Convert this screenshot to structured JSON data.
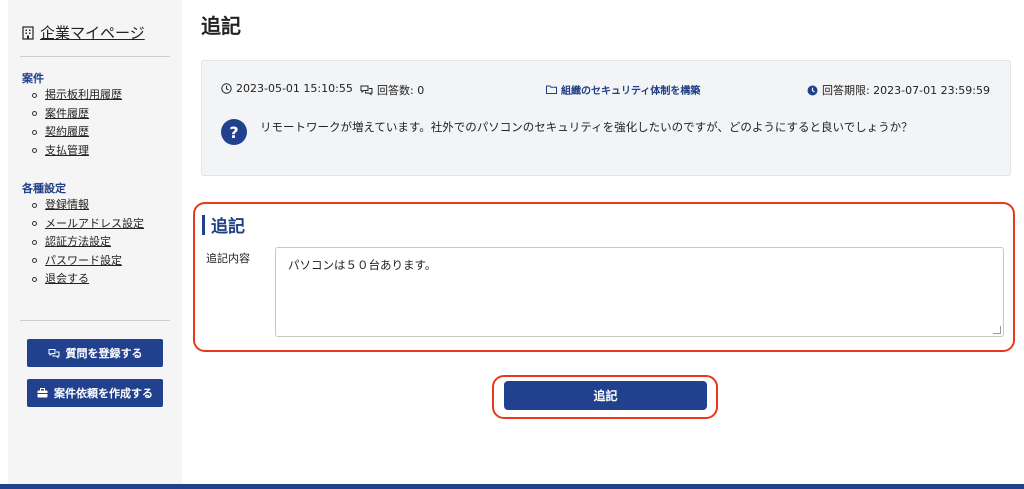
{
  "sidebar": {
    "brand": "企業マイページ",
    "section1_title": "案件",
    "section1_items": [
      "掲示板利用履歴",
      "案件履歴",
      "契約履歴",
      "支払管理"
    ],
    "section2_title": "各種設定",
    "section2_items": [
      "登録情報",
      "メールアドレス設定",
      "認証方法設定",
      "パスワード設定",
      "退会する"
    ],
    "buttons": {
      "register_question": "質問を登録する",
      "create_request": "案件依頼を作成する"
    }
  },
  "main": {
    "title": "追記",
    "question": {
      "posted_at": "2023-05-01 15:10:55",
      "answer_count": "回答数: 0",
      "category": "組織のセキュリティ体制を構築",
      "deadline": "回答期限: 2023-07-01 23:59:59",
      "text": "リモートワークが増えています。社外でのパソコンのセキュリティを強化したいのですが、どのようにすると良いでしょうか？",
      "icon_text": "?"
    },
    "section_title": "追記",
    "field_label": "追記内容",
    "field_value": "パソコンは５０台あります。",
    "submit_label": "追記"
  },
  "colors": {
    "brand": "#21418f",
    "highlight": "#e8391a"
  }
}
